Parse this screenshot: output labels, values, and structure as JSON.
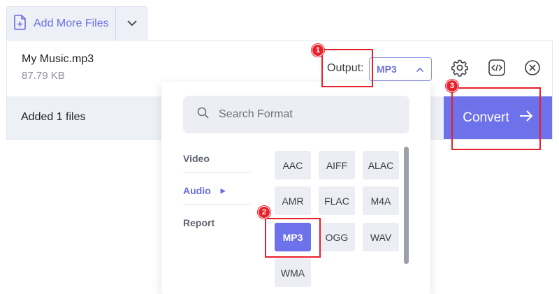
{
  "toolbar": {
    "add_files_label": "Add More Files"
  },
  "file": {
    "name": "My Music.mp3",
    "size": "87.79 KB"
  },
  "status": {
    "added_text": "Added 1 files"
  },
  "output": {
    "label": "Output:",
    "selected_format": "MP3"
  },
  "convert": {
    "label": "Convert"
  },
  "format_menu": {
    "search_placeholder": "Search Format",
    "categories": [
      "Video",
      "Audio",
      "Report"
    ],
    "active_category": "Audio",
    "formats": [
      "AAC",
      "AIFF",
      "ALAC",
      "AMR",
      "FLAC",
      "M4A",
      "MP3",
      "OGG",
      "WAV",
      "WMA"
    ],
    "selected_format": "MP3"
  },
  "annotations": {
    "badges": [
      "1",
      "2",
      "3"
    ]
  },
  "colors": {
    "accent": "#6e72ea",
    "highlight": "#e8202a",
    "panel_bg": "#eef0f8"
  }
}
